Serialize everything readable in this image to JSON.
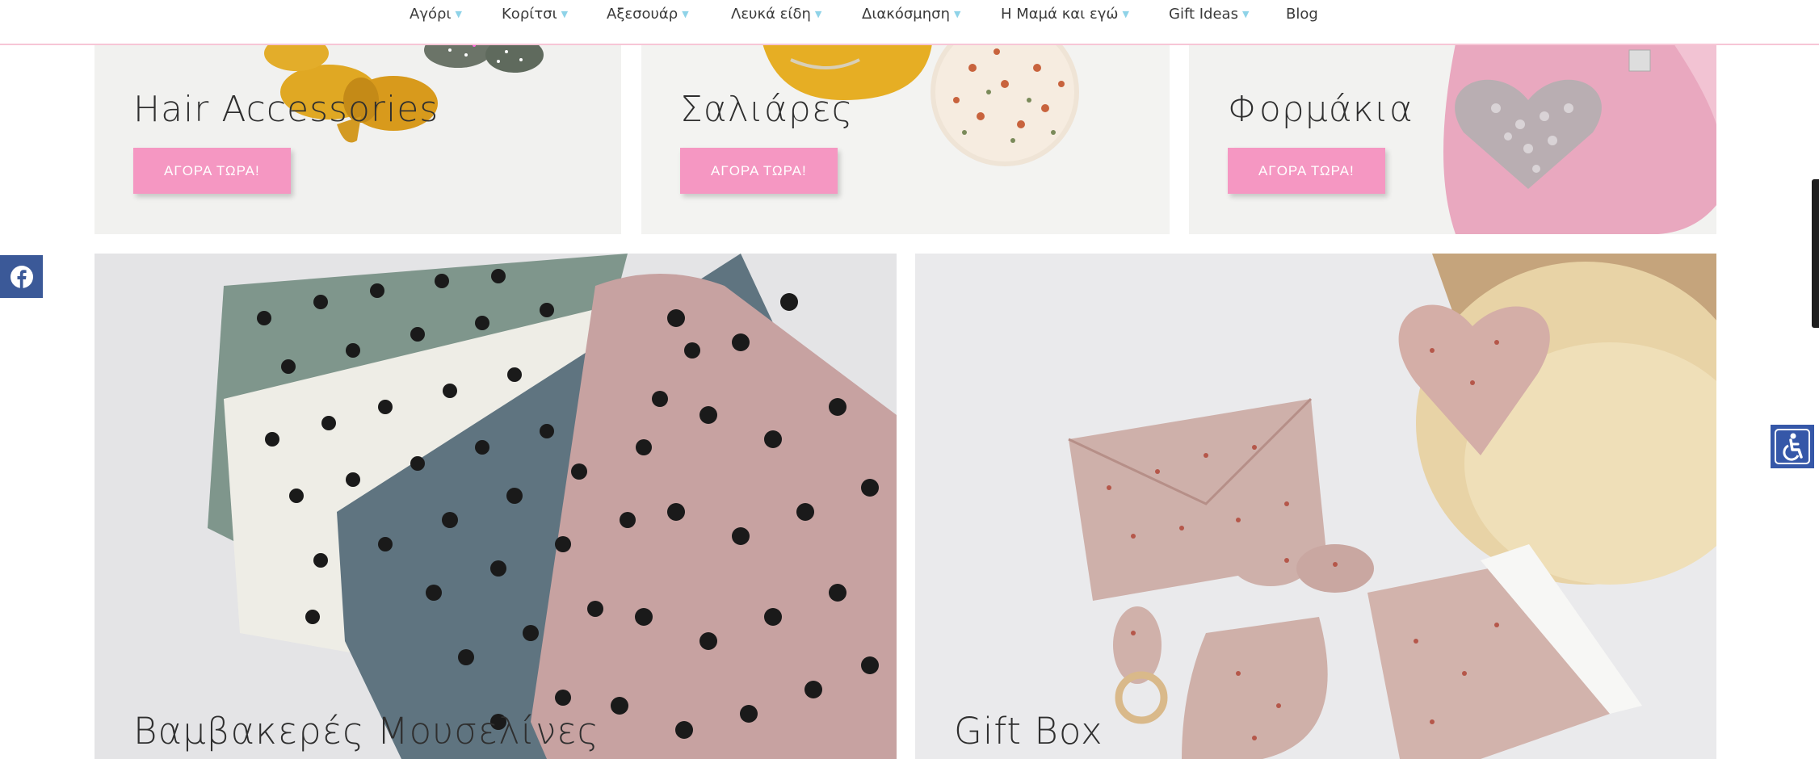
{
  "nav": {
    "items": [
      {
        "label": "Αγόρι",
        "has_submenu": true
      },
      {
        "label": "Κορίτσι",
        "has_submenu": true
      },
      {
        "label": "Αξεσουάρ",
        "has_submenu": true
      },
      {
        "label": "Λευκά είδη",
        "has_submenu": true
      },
      {
        "label": "Διακόσμηση",
        "has_submenu": true
      },
      {
        "label": "Η Μαμά και εγώ",
        "has_submenu": true
      },
      {
        "label": "Gift Ideas",
        "has_submenu": true
      },
      {
        "label": "Blog",
        "has_submenu": false
      }
    ]
  },
  "cards": {
    "top": [
      {
        "title": "Hair Accessories",
        "button": "ΑΓΟΡΑ ΤΩΡΑ!"
      },
      {
        "title": "Σαλιάρες",
        "button": "ΑΓΟΡΑ ΤΩΡΑ!"
      },
      {
        "title": "Φορμάκια",
        "button": "ΑΓΟΡΑ ΤΩΡΑ!"
      }
    ],
    "bottom": [
      {
        "title": "Βαμβακερές Μουσελίνες"
      },
      {
        "title": "Gift Box"
      }
    ]
  },
  "widgets": {
    "facebook": "facebook-icon",
    "accessibility": "accessibility-icon"
  },
  "colors": {
    "accent_pink": "#f597c2",
    "nav_border": "#f7c6d6",
    "caret": "#8fd3e8",
    "facebook": "#3b5998",
    "accessibility": "#3557a8"
  }
}
